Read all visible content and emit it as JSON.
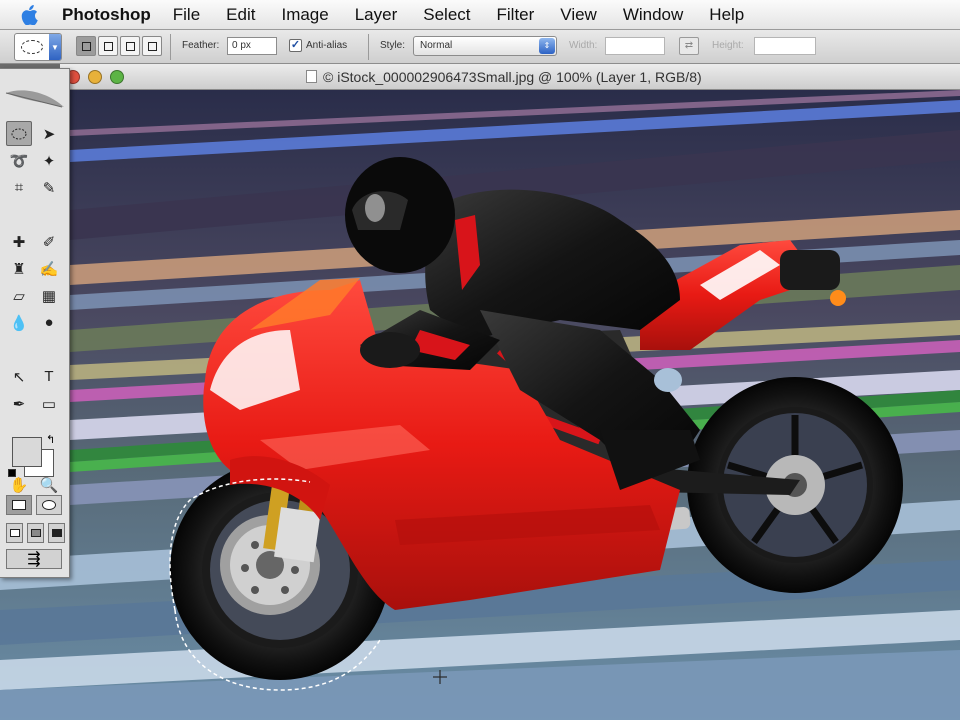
{
  "menubar": {
    "apple_icon": "apple-logo",
    "app_name": "Photoshop",
    "menus": [
      "File",
      "Edit",
      "Image",
      "Layer",
      "Select",
      "Filter",
      "View",
      "Window",
      "Help"
    ]
  },
  "options": {
    "preset_icon": "elliptical-marquee-icon",
    "feather_label": "Feather:",
    "feather_value": "0 px",
    "antialias_label": "Anti-alias",
    "antialias_checked": true,
    "style_label": "Style:",
    "style_value": "Normal",
    "width_label": "Width:",
    "height_label": "Height:"
  },
  "document": {
    "title": "iStock_000002906473Small.jpg @ 100% (Layer 1, RGB/8)",
    "title_prefix": "©"
  },
  "tools": {
    "active": "elliptical-marquee",
    "foreground_color": "#d9d9d9",
    "background_color": "#ffffff"
  },
  "colors": {
    "accent_blue": "#2f63c2",
    "close": "#e0503f",
    "minimize": "#e8b13a",
    "zoom": "#5cb445"
  }
}
